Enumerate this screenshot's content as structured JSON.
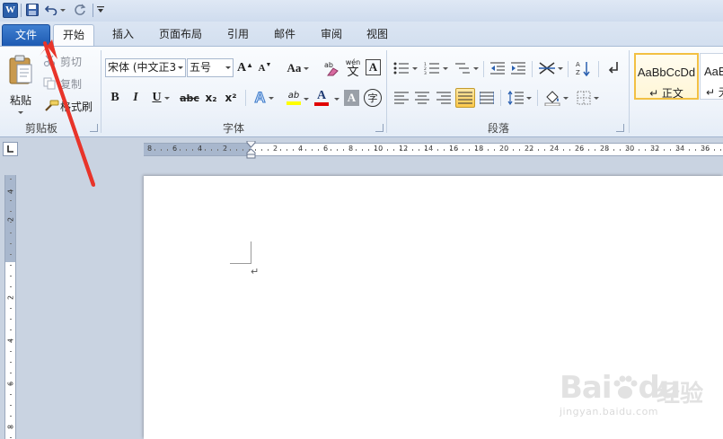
{
  "app": {
    "logo_letter": "W"
  },
  "tabs": {
    "file": "文件",
    "items": [
      "开始",
      "插入",
      "页面布局",
      "引用",
      "邮件",
      "审阅",
      "视图"
    ],
    "active_index": 0
  },
  "clipboard": {
    "paste": "粘贴",
    "cut": "剪切",
    "copy": "复制",
    "format_painter": "格式刷",
    "group_label": "剪贴板"
  },
  "font": {
    "name_value": "宋体 (中文正3",
    "size_value": "五号",
    "grow": "A",
    "shrink": "A",
    "change_case": "Aa",
    "bold": "B",
    "italic": "I",
    "underline": "U",
    "strike": "abc",
    "subscript": "x₂",
    "superscript": "x²",
    "text_effect": "A",
    "highlight": "ab",
    "font_color": "A",
    "char_shading": "A",
    "enclose": "字",
    "phonetic_small": "wén",
    "phonetic_big": "文",
    "char_border": "A",
    "group_label": "字体"
  },
  "paragraph": {
    "group_label": "段落"
  },
  "styles": {
    "items": [
      {
        "sample": "AaBbCcDd",
        "name": "↵ 正文",
        "selected": true
      },
      {
        "sample": "AaBb",
        "name": "↵ 无",
        "selected": false
      }
    ]
  },
  "ruler": {
    "h_labels": [
      "8",
      "6",
      "4",
      "2",
      "2",
      "4",
      "6",
      "8",
      "10",
      "12",
      "14",
      "16",
      "18",
      "20",
      "22",
      "24",
      "26",
      "28",
      "30",
      "32",
      "34",
      "36"
    ],
    "v_labels": [
      "4",
      "2",
      "2",
      "4",
      "6",
      "8"
    ]
  },
  "document": {
    "para_mark": "↵"
  },
  "watermark": {
    "brand": "Bai",
    "brand2": "du",
    "cn": "经验",
    "url": "jingyan.baidu.com"
  },
  "colors": {
    "file_tab": "#2a66bd",
    "highlight": "#ffff00",
    "font_color": "#e00000",
    "annotation_arrow": "#e8342a",
    "selected_style": "#f2c043"
  }
}
